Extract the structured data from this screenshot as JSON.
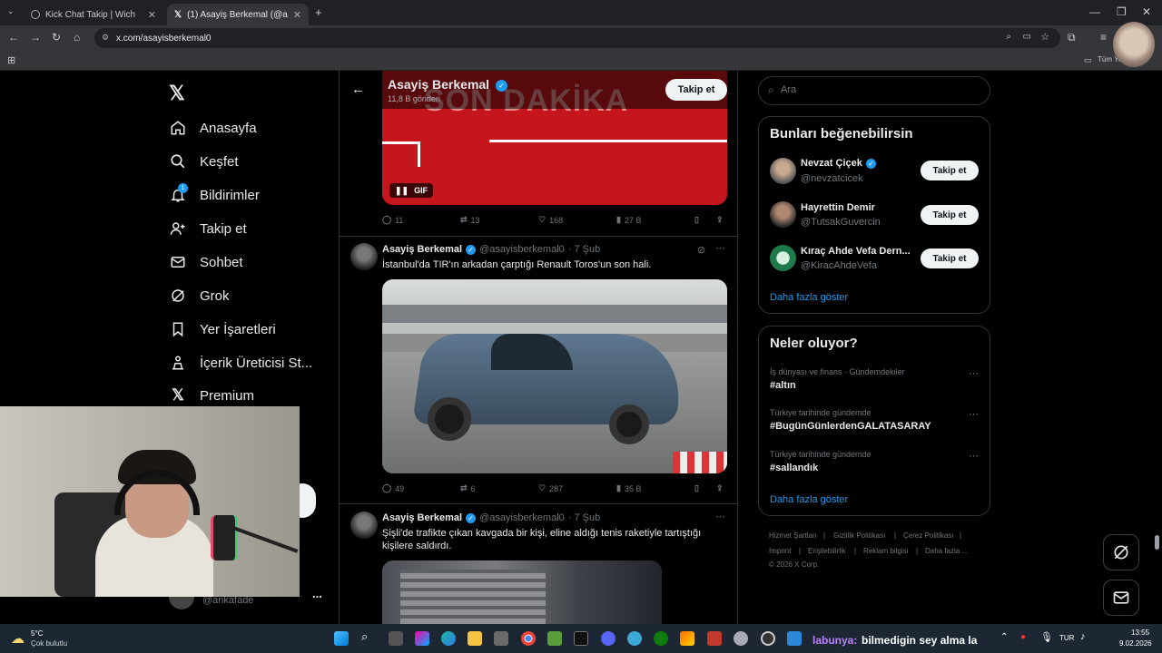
{
  "browser": {
    "tabs": [
      {
        "title": "Kick Chat Takip | Wich",
        "active": false
      },
      {
        "title": "(1) Asayiş Berkemal (@asayisbe",
        "active": true
      }
    ],
    "url": "x.com/asayisberkemal0",
    "bookmarks_right": "Tüm Ye"
  },
  "nav": {
    "items": [
      {
        "label": "Anasayfa",
        "icon": "home-icon"
      },
      {
        "label": "Keşfet",
        "icon": "search-icon"
      },
      {
        "label": "Bildirimler",
        "icon": "bell-icon"
      },
      {
        "label": "Takip et",
        "icon": "follow-icon"
      },
      {
        "label": "Sohbet",
        "icon": "mail-icon"
      },
      {
        "label": "Grok",
        "icon": "grok-icon"
      },
      {
        "label": "Yer İşaretleri",
        "icon": "bookmark-icon"
      },
      {
        "label": "İçerik Üreticisi St...",
        "icon": "creator-icon"
      },
      {
        "label": "Premium",
        "icon": "x-logo-icon"
      }
    ],
    "notification_badge": "1",
    "account_handle": "@ankafade",
    "more": "..."
  },
  "profile": {
    "name": "Asayiş Berkemal",
    "posts": "11,8 B gönderi",
    "follow_label": "Takip et"
  },
  "top_tweet": {
    "banner_text": "SON DAKİKA",
    "gif_label": "GIF",
    "stats": {
      "replies": "11",
      "reposts": "13",
      "likes": "168",
      "views": "27 B"
    }
  },
  "tweets": [
    {
      "name": "Asayiş Berkemal",
      "handle": "@asayisberkemal0",
      "time": "· 7 Şub",
      "text": "İstanbul'da TIR'ın arkadan çarptığı Renault Toros'un son hali.",
      "stats": {
        "replies": "49",
        "reposts": "6",
        "likes": "287",
        "views": "35 B"
      }
    },
    {
      "name": "Asayiş Berkemal",
      "handle": "@asayisberkemal0",
      "time": "· 7 Şub",
      "text": "Şişli'de trafikte çıkan kavgada bir kişi, eline aldığı tenis raketiyle tartıştığı kişilere saldırdı."
    }
  ],
  "search": {
    "placeholder": "Ara"
  },
  "suggestions": {
    "title": "Bunları beğenebilirsin",
    "items": [
      {
        "name": "Nevzat Çiçek",
        "handle": "@nevzatcicek",
        "verified": true,
        "button": "Takip et"
      },
      {
        "name": "Hayrettin Demir",
        "handle": "@TutsakGuvercin",
        "verified": false,
        "button": "Takip et"
      },
      {
        "name": "Kıraç Ahde Vefa Dern...",
        "handle": "@KiracAhdeVefa",
        "verified": false,
        "button": "Takip et"
      }
    ],
    "show_more": "Daha fazla göster"
  },
  "trends": {
    "title": "Neler oluyor?",
    "items": [
      {
        "category": "İş dünyası ve finans · Gündemdekiler",
        "tag": "#altın"
      },
      {
        "category": "Türkiye tarihinde gündemde",
        "tag": "#BugünGünlerdenGALATASARAY"
      },
      {
        "category": "Türkiye tarihinde gündemde",
        "tag": "#sallandık"
      }
    ],
    "show_more": "Daha fazla göster"
  },
  "footer": {
    "links": [
      "Hizmet Şartları",
      "|",
      "Gizlilik Politikası",
      "|",
      "Çerez Politikası",
      "|",
      "Imprint",
      "|",
      "Erişilebilirlik",
      "|",
      "Reklam bilgisi",
      "|",
      "Daha fazla ..."
    ],
    "copyright": "© 2026 X Corp."
  },
  "taskbar": {
    "weather_temp": "5°C",
    "weather_desc": "Çok bulutlu",
    "chat_user": "labunya:",
    "chat_message": "bilmedigin sey alma la",
    "lang": "TUR",
    "time": "13:55",
    "date": "9.02.2026"
  },
  "colors": {
    "accent": "#1d9bf0",
    "banner_red": "#c4161c"
  }
}
